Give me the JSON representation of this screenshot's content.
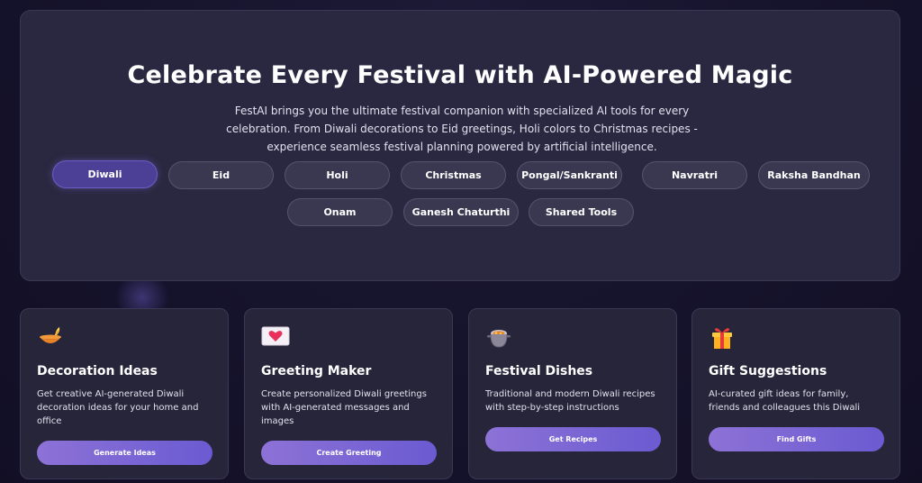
{
  "hero": {
    "title": "Celebrate Every Festival with AI-Powered Magic",
    "description_lines": [
      "FestAI brings you the ultimate festival companion with specialized AI tools for every",
      "celebration. From Diwali decorations to Eid greetings, Holi colors to Christmas recipes -",
      "experience seamless festival planning powered by artificial intelligence."
    ]
  },
  "festival_tabs": [
    {
      "label": "Diwali",
      "active": true
    },
    {
      "label": "Eid",
      "active": false
    },
    {
      "label": "Holi",
      "active": false
    },
    {
      "label": "Christmas",
      "active": false
    },
    {
      "label": "Pongal/Sankranti",
      "active": false
    },
    {
      "label": "Navratri",
      "active": false
    },
    {
      "label": "Raksha Bandhan",
      "active": false
    },
    {
      "label": "Onam",
      "active": false
    },
    {
      "label": "Ganesh Chaturthi",
      "active": false
    },
    {
      "label": "Shared Tools",
      "active": false
    }
  ],
  "cards": [
    {
      "icon": "diya-lamp-icon",
      "title": "Decoration Ideas",
      "description_lines": [
        "Get creative AI-generated Diwali",
        "decoration ideas for your home and",
        "office"
      ],
      "button": "Generate Ideas"
    },
    {
      "icon": "heart-greeting-card-icon",
      "title": "Greeting Maker",
      "description_lines": [
        "Create personalized Diwali greetings",
        "with AI-generated messages and",
        "images"
      ],
      "button": "Create Greeting"
    },
    {
      "icon": "cooking-pot-icon",
      "title": "Festival Dishes",
      "description_lines": [
        "Traditional and modern Diwali recipes",
        "with step-by-step instructions"
      ],
      "button": "Get Recipes"
    },
    {
      "icon": "gift-box-icon",
      "title": "Gift Suggestions",
      "description_lines": [
        "AI-curated gift ideas for family,",
        "friends and colleagues this Diwali"
      ],
      "button": "Find Gifts"
    }
  ],
  "colors": {
    "accent": "#6a5bd2",
    "accent_light": "#8d72d6",
    "active_tab": "#4b3f96",
    "panel": "#2a2840",
    "background": "#15122b"
  }
}
